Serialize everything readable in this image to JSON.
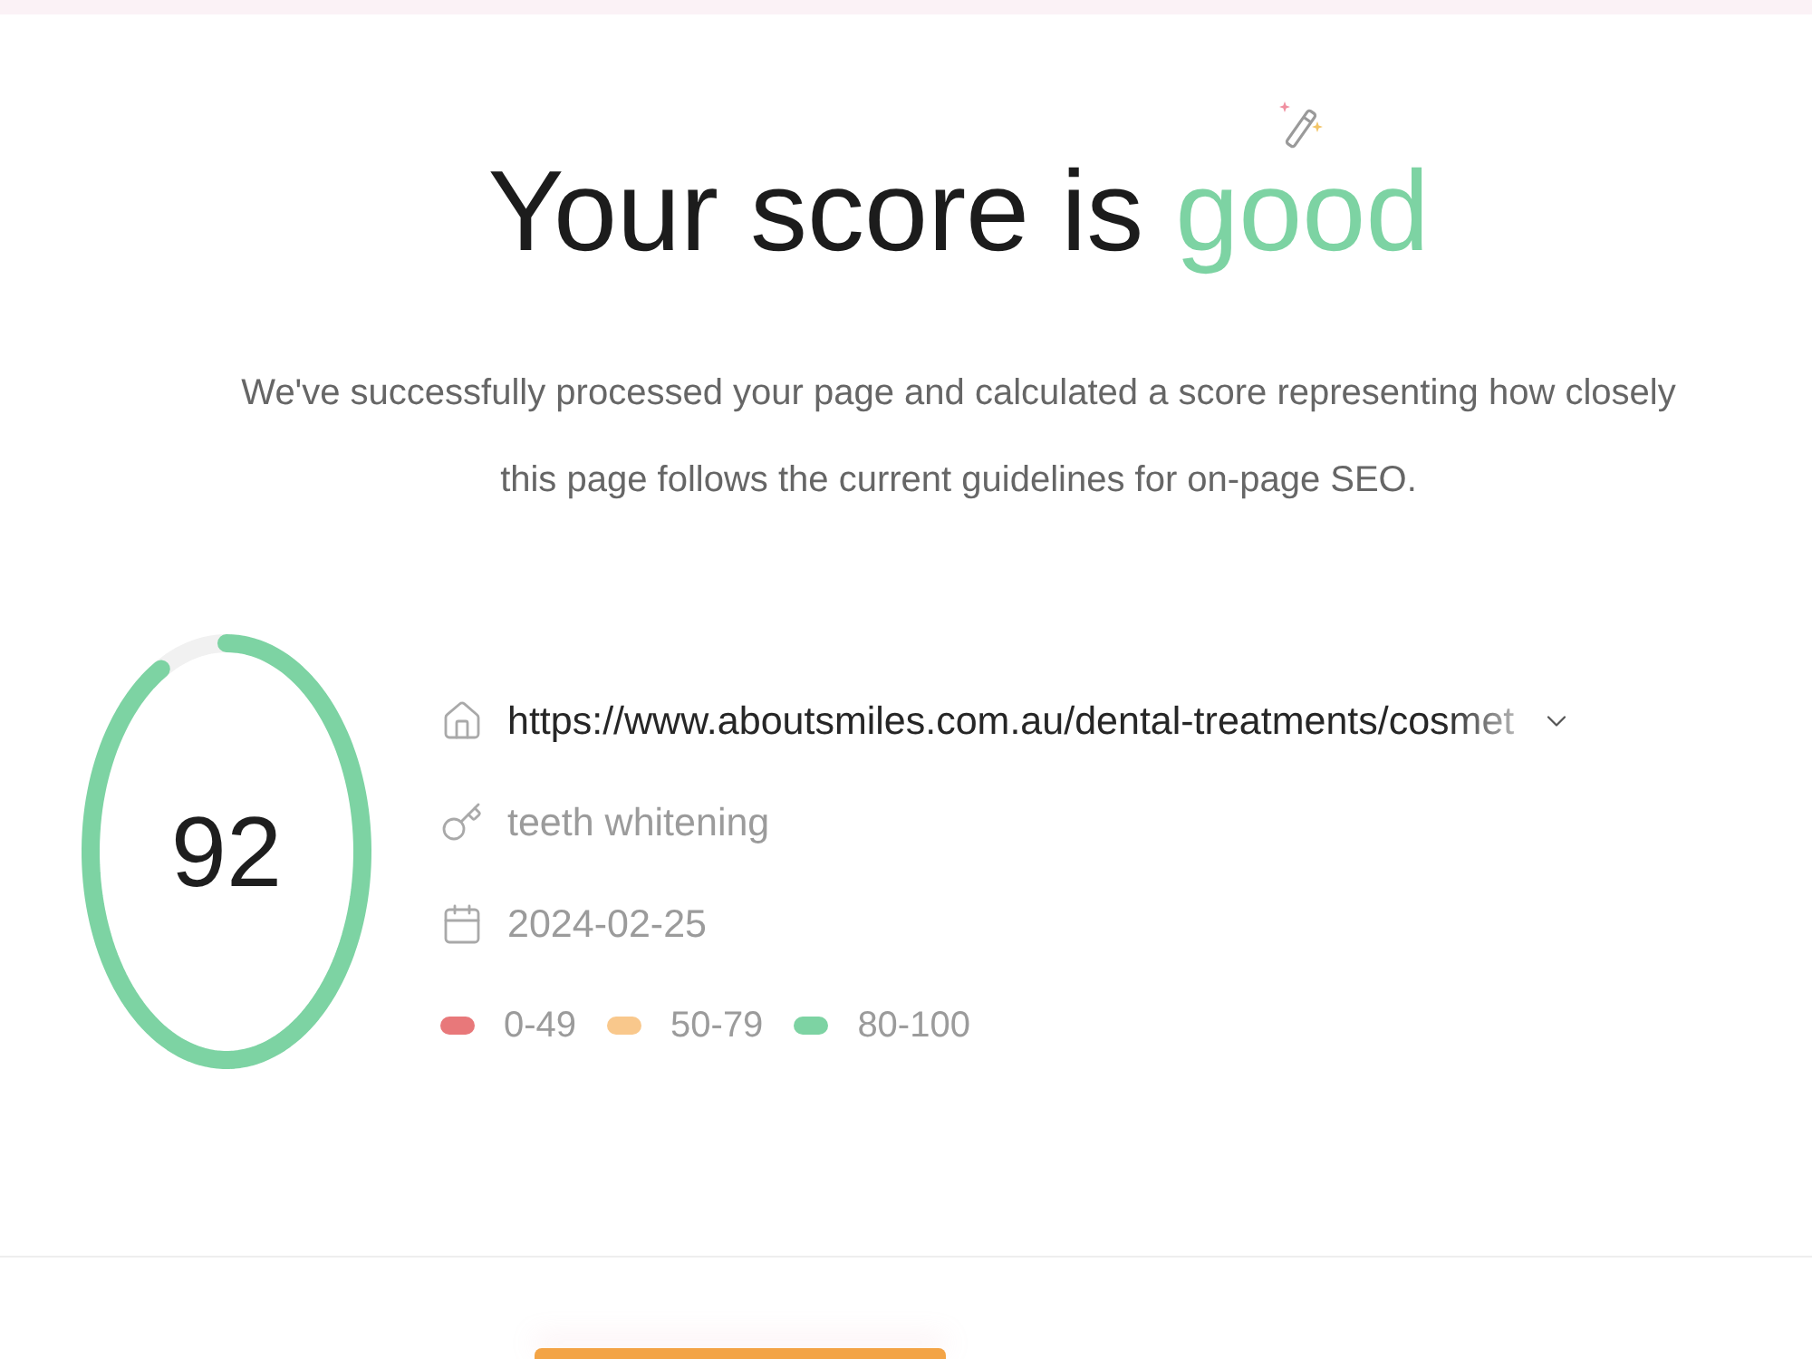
{
  "title": {
    "prefix": "Your score is",
    "rating": "good"
  },
  "description": "We've successfully processed your page and calculated a score representing how closely this page follows the current guidelines for on-page SEO.",
  "score": {
    "value": "92",
    "level": 0.92
  },
  "details": [
    {
      "kind": "url",
      "text": "https://www.aboutsmiles.com.au/dental-treatments/cosmet"
    },
    {
      "kind": "keyword",
      "text": "teeth whitening"
    },
    {
      "kind": "date",
      "text": "2024-02-25"
    }
  ],
  "legend": [
    {
      "label": "0-49",
      "color": "#e8787a"
    },
    {
      "label": "50-79",
      "color": "#f9c88c"
    },
    {
      "label": "80-100",
      "color": "#7dd3a3"
    }
  ]
}
